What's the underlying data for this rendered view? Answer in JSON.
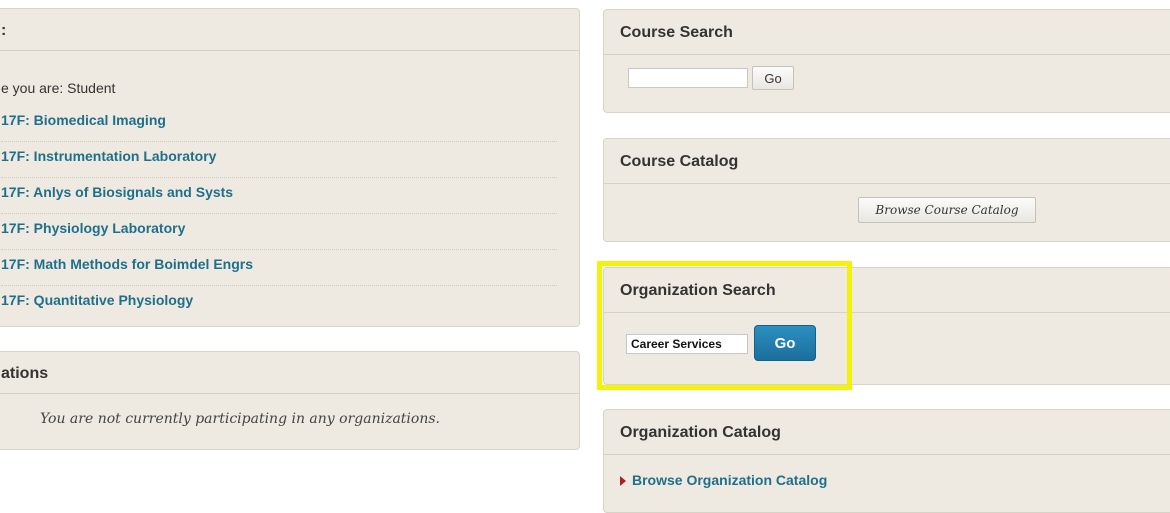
{
  "courses_panel": {
    "title": ":",
    "role_line": "e you are: Student",
    "courses": [
      {
        "label": "17F: Biomedical Imaging"
      },
      {
        "label": "17F: Instrumentation Laboratory"
      },
      {
        "label": "17F: Anlys of Biosignals and Systs"
      },
      {
        "label": "17F: Physiology Laboratory"
      },
      {
        "label": "17F: Math Methods for Boimdel Engrs"
      },
      {
        "label": "17F: Quantitative Physiology"
      }
    ]
  },
  "organizations_panel": {
    "title": "ations",
    "empty_message": "You are not currently participating in any organizations."
  },
  "course_search": {
    "title": "Course Search",
    "input_value": "",
    "go_label": "Go"
  },
  "course_catalog": {
    "title": "Course Catalog",
    "browse_label": "Browse Course Catalog"
  },
  "organization_search": {
    "title": "Organization Search",
    "input_value": "Career Services",
    "go_label": "Go"
  },
  "organization_catalog": {
    "title": "Organization Catalog",
    "browse_label": "Browse Organization Catalog"
  },
  "colors": {
    "panel_bg": "#eeeae2",
    "link": "#1f6f8b",
    "primary_button": "#1b6f9d",
    "highlight": "#f4f20b",
    "arrow": "#b21f1f"
  }
}
